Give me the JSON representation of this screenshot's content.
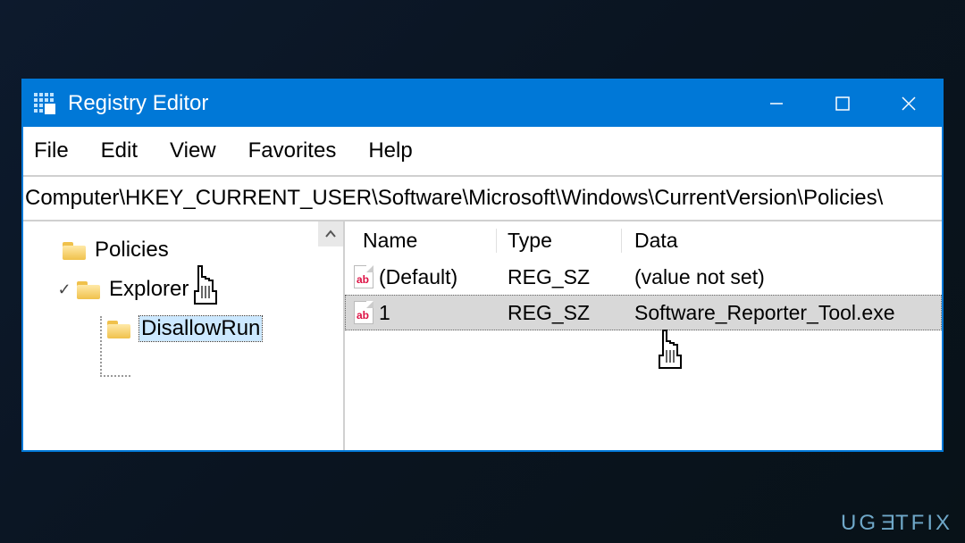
{
  "window": {
    "title": "Registry Editor"
  },
  "menu": {
    "file": "File",
    "edit": "Edit",
    "view": "View",
    "favorites": "Favorites",
    "help": "Help"
  },
  "address": "Computer\\HKEY_CURRENT_USER\\Software\\Microsoft\\Windows\\CurrentVersion\\Policies\\",
  "tree": {
    "node0": "Policies",
    "node1": "Explorer",
    "node2": "DisallowRun"
  },
  "list": {
    "headers": {
      "name": "Name",
      "type": "Type",
      "data": "Data"
    },
    "rows": [
      {
        "name": "(Default)",
        "type": "REG_SZ",
        "data": "(value not set)"
      },
      {
        "name": "1",
        "type": "REG_SZ",
        "data": "Software_Reporter_Tool.exe"
      }
    ]
  },
  "watermark": "UGETFIX"
}
